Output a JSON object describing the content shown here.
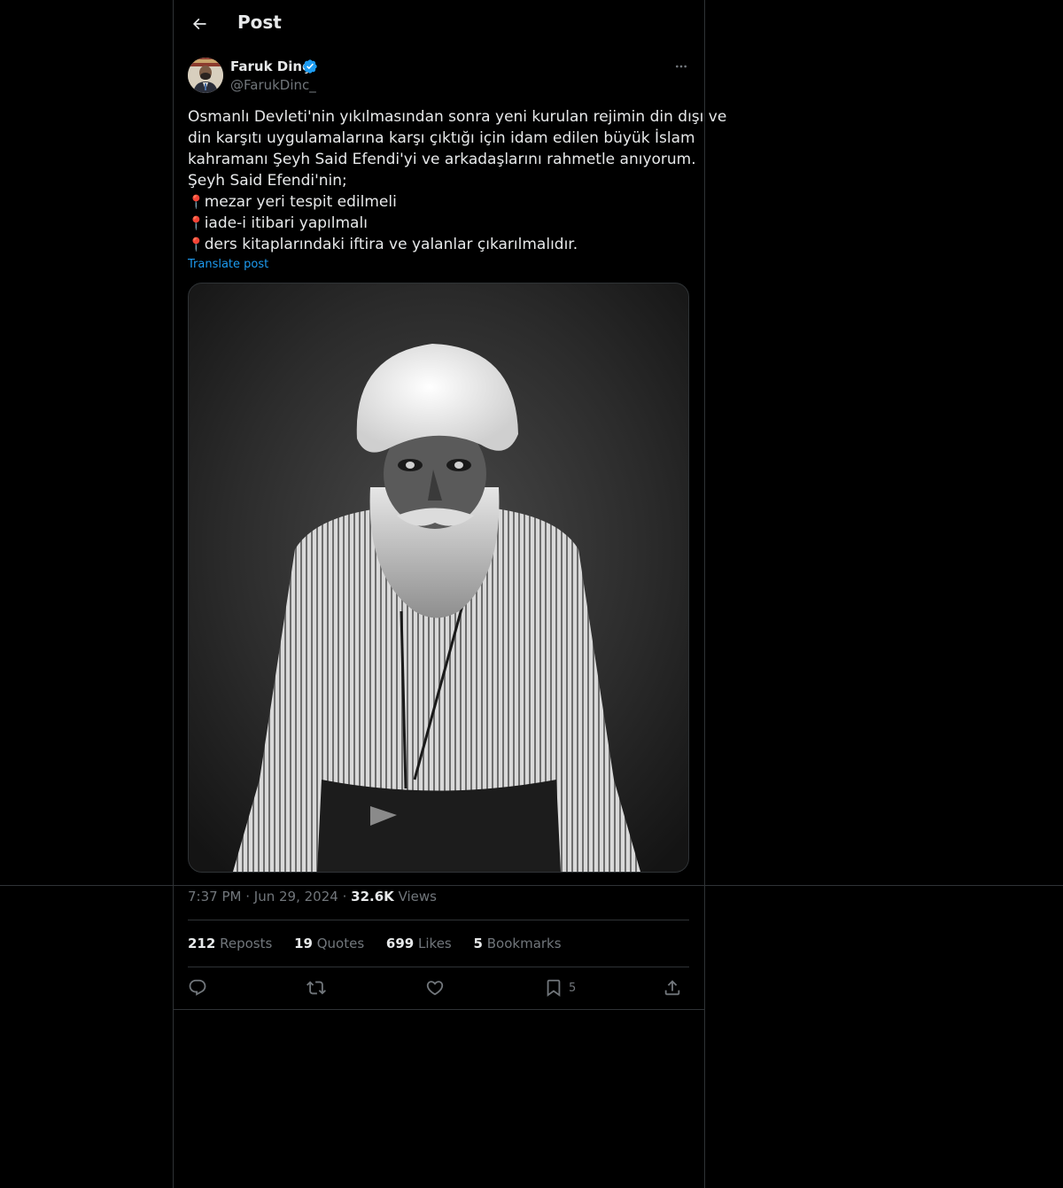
{
  "header": {
    "title": "Post"
  },
  "author": {
    "display_name": "Faruk Dinç",
    "handle": "@FarukDinc_",
    "verified_color": "#1d9bf0"
  },
  "post": {
    "lines": [
      "Osmanlı Devleti'nin yıkılmasından sonra yeni kurulan rejimin din dışı ve",
      "din karşıtı uygulamalarına karşı çıktığı için idam edilen büyük İslam",
      "kahramanı Şeyh Said Efendi'yi ve arkadaşlarını rahmetle anıyorum.",
      "Şeyh Said Efendi'nin;",
      "mezar yeri tespit edilmeli",
      "iade-i itibari yapılmalı",
      "ders kitaplarındaki iftira ve yalanlar çıkarılmalıdır."
    ],
    "pin_emoji": "📍",
    "translate_label": "Translate post"
  },
  "meta": {
    "time": "7:37 PM",
    "dot1": "·",
    "date": "Jun 29, 2024",
    "dot2": "·",
    "views_count": "32.6K",
    "views_label": "Views"
  },
  "stats": {
    "reposts_count": "212",
    "reposts_label": "Reposts",
    "quotes_count": "19",
    "quotes_label": "Quotes",
    "likes_count": "699",
    "likes_label": "Likes",
    "bookmarks_count": "5",
    "bookmarks_label": "Bookmarks"
  },
  "actions": {
    "bookmark_count": "5"
  },
  "colors": {
    "background": "#000000",
    "text": "#e7e9ea",
    "secondary": "#71767b",
    "link": "#1d9bf0",
    "border": "#2f3336"
  }
}
